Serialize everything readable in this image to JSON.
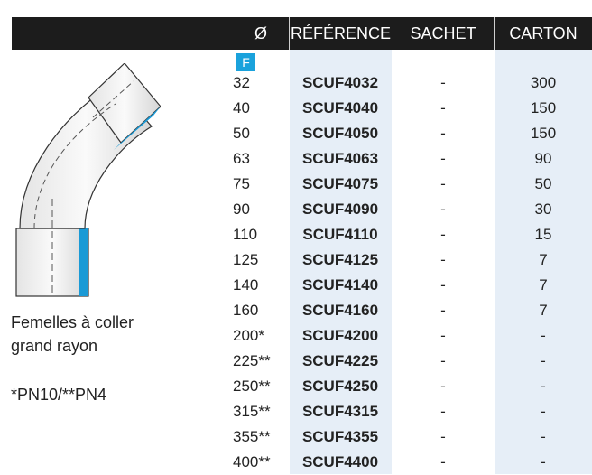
{
  "header": {
    "diameter": "Ø",
    "reference": "RÉFÉRENCE",
    "sachet": "SACHET",
    "carton": "CARTON"
  },
  "badge": "F",
  "product": {
    "name_line1": "Femelles à coller",
    "name_line2": "grand rayon",
    "pressure_note": "*PN10/**PN4"
  },
  "rows": [
    {
      "d": "32",
      "ref": "SCUF4032",
      "sachet": "-",
      "carton": "300"
    },
    {
      "d": "40",
      "ref": "SCUF4040",
      "sachet": "-",
      "carton": "150"
    },
    {
      "d": "50",
      "ref": "SCUF4050",
      "sachet": "-",
      "carton": "150"
    },
    {
      "d": "63",
      "ref": "SCUF4063",
      "sachet": "-",
      "carton": "90"
    },
    {
      "d": "75",
      "ref": "SCUF4075",
      "sachet": "-",
      "carton": "50"
    },
    {
      "d": "90",
      "ref": "SCUF4090",
      "sachet": "-",
      "carton": "30"
    },
    {
      "d": "110",
      "ref": "SCUF4110",
      "sachet": "-",
      "carton": "15"
    },
    {
      "d": "125",
      "ref": "SCUF4125",
      "sachet": "-",
      "carton": "7"
    },
    {
      "d": "140",
      "ref": "SCUF4140",
      "sachet": "-",
      "carton": "7"
    },
    {
      "d": "160",
      "ref": "SCUF4160",
      "sachet": "-",
      "carton": "7"
    },
    {
      "d": "200*",
      "ref": "SCUF4200",
      "sachet": "-",
      "carton": "-"
    },
    {
      "d": "225**",
      "ref": "SCUF4225",
      "sachet": "-",
      "carton": "-"
    },
    {
      "d": "250**",
      "ref": "SCUF4250",
      "sachet": "-",
      "carton": "-"
    },
    {
      "d": "315**",
      "ref": "SCUF4315",
      "sachet": "-",
      "carton": "-"
    },
    {
      "d": "355**",
      "ref": "SCUF4355",
      "sachet": "-",
      "carton": "-"
    },
    {
      "d": "400**",
      "ref": "SCUF4400",
      "sachet": "-",
      "carton": "-"
    }
  ]
}
